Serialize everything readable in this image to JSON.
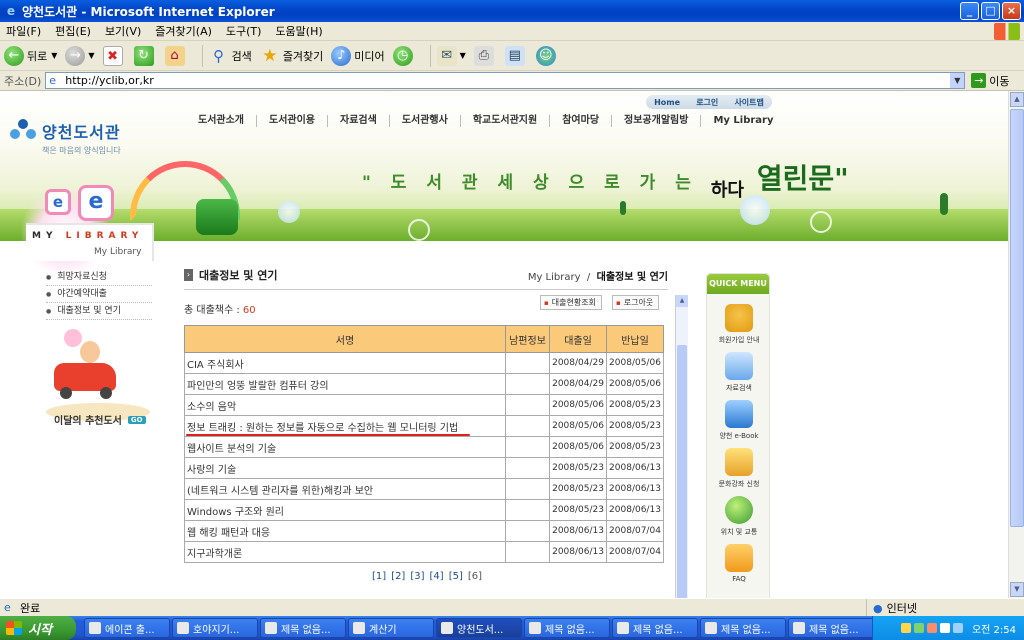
{
  "window": {
    "title": "양천도서관 - Microsoft Internet Explorer"
  },
  "menubar": [
    "파일(F)",
    "편집(E)",
    "보기(V)",
    "즐겨찾기(A)",
    "도구(T)",
    "도움말(H)"
  ],
  "toolbar": {
    "back": "뒤로",
    "search": "검색",
    "favorites": "즐겨찾기",
    "media": "미디어"
  },
  "address": {
    "label": "주소(D)",
    "url": "http://yclib,or,kr",
    "go": "이동"
  },
  "site": {
    "logo_name": "양천도서관",
    "logo_slogan": "책은 마음의 양식입니다",
    "util_nav": [
      "Home",
      "로그인",
      "사이트맵"
    ],
    "gnav": [
      "도서관소개",
      "도서관이용",
      "자료검색",
      "도서관행사",
      "학교도서관지원",
      "참여마당",
      "정보공개알림방",
      "My Library"
    ],
    "banner": {
      "lead": "\" 도 서 관  세 상 으 로 가 는",
      "big": "열린문\"",
      "small": "하다"
    },
    "section_tab": {
      "title": "MY LIBRARY",
      "title_red": "LIBRARY",
      "title_black": "MY",
      "subtitle": "My Library"
    }
  },
  "sidebar": {
    "items": [
      "희망자료신청",
      "야간예약대출",
      "대출정보 및 연기"
    ],
    "recommend_label": "이달의 추천도서",
    "recommend_badge": "GO"
  },
  "content": {
    "page_title": "대출정보 및 연기",
    "breadcrumb_parent": "My Library",
    "breadcrumb_sep": "/",
    "breadcrumb_current": "대출정보 및 연기",
    "total_label": "총 대출책수 : ",
    "total_count": "60",
    "btn_status": "대출현황조회",
    "btn_logout": "로그아웃",
    "columns": [
      "서명",
      "남편정보",
      "대출일",
      "반납일"
    ],
    "rows": [
      {
        "title": "CIA 주식회사",
        "extra": "",
        "loan": "2008/04/29",
        "due": "2008/05/06"
      },
      {
        "title": "파인만의 엉뚱 발랄한 컴퓨터 강의",
        "extra": "",
        "loan": "2008/04/29",
        "due": "2008/05/06"
      },
      {
        "title": "소수의 음악",
        "extra": "",
        "loan": "2008/05/06",
        "due": "2008/05/23"
      },
      {
        "title": "정보 트래킹 : 원하는 정보를 자동으로 수집하는 웹 모니터링 기법",
        "extra": "",
        "loan": "2008/05/06",
        "due": "2008/05/23"
      },
      {
        "title": "웹사이트 분석의 기술",
        "extra": "",
        "loan": "2008/05/06",
        "due": "2008/05/23"
      },
      {
        "title": "사랑의 기술",
        "extra": "",
        "loan": "2008/05/23",
        "due": "2008/06/13"
      },
      {
        "title": "(네트워크 시스템 관리자를 위한)해킹과 보안",
        "extra": "",
        "loan": "2008/05/23",
        "due": "2008/06/13"
      },
      {
        "title": "Windows 구조와 원리",
        "extra": "",
        "loan": "2008/05/23",
        "due": "2008/06/13"
      },
      {
        "title": "웹 해킹 패턴과 대응",
        "extra": "",
        "loan": "2008/06/13",
        "due": "2008/07/04"
      },
      {
        "title": "지구과학개론",
        "extra": "",
        "loan": "2008/06/13",
        "due": "2008/07/04"
      }
    ],
    "pages": [
      "[1]",
      "[2]",
      "[3]",
      "[4]",
      "[5]",
      "[6]"
    ]
  },
  "quick_menu": {
    "header": "QUICK MENU",
    "items": [
      "회원가입 안내",
      "자료검색",
      "양천 e-Book",
      "문화강좌 신청",
      "위치 및 교통",
      "FAQ"
    ]
  },
  "statusbar": {
    "text": "완료",
    "zone": "인터넷"
  },
  "taskbar": {
    "start": "시작",
    "tasks": [
      "에이콘 출...",
      "호야지기...",
      "제목 없음...",
      "계산기",
      "양천도서...",
      "제목 없음...",
      "제목 없음...",
      "제목 없음...",
      "제목 없음..."
    ],
    "clock": "오전 2:54"
  }
}
